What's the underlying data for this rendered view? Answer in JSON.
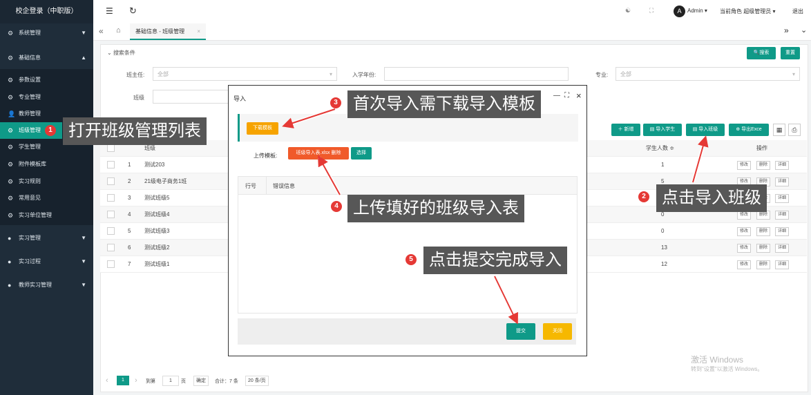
{
  "sidebar": {
    "brand": "校企登录（中职版）",
    "items": [
      {
        "label": "系统管理",
        "caret": "▼"
      },
      {
        "label": "基础信息",
        "caret": "▲"
      },
      {
        "label": "参数设置"
      },
      {
        "label": "专业管理"
      },
      {
        "label": "教师管理"
      },
      {
        "label": "班级管理"
      },
      {
        "label": "学生管理"
      },
      {
        "label": "附件模板库"
      },
      {
        "label": "实习规则"
      },
      {
        "label": "常用意见"
      },
      {
        "label": "实习单位管理"
      },
      {
        "label": "实习管理",
        "caret": "▼"
      },
      {
        "label": "实习过程",
        "caret": "▼"
      },
      {
        "label": "教师实习管理",
        "caret": "▼"
      }
    ]
  },
  "topbar": {
    "menu_icon": "☰",
    "refresh_icon": "↻",
    "avatar_letter": "A",
    "user": "Admin ▾",
    "role": "当前角色 超级管理员 ▾",
    "logout": "退出"
  },
  "tabs": {
    "left_arrow": "«",
    "home_icon": "⌂",
    "active_tab": "基础信息 - 班级管理",
    "close": "×",
    "right_arrow": "»",
    "down_icon": "⌄"
  },
  "search": {
    "title": "搜索条件",
    "search_btn": "搜索",
    "reset_btn": "重置",
    "headteacher_label": "班主任:",
    "headteacher_value": "全部",
    "year_label": "入学年份:",
    "major_label": "专业:",
    "major_value": "全部",
    "class_label": "班级"
  },
  "toolbar": {
    "new": "＋ 新增",
    "import_student": "导入学生",
    "import_class": "导入班级",
    "export_excel": "导出Exce"
  },
  "table": {
    "col_class": "班级",
    "col_students": "学生人数 ≑",
    "col_ops": "操作",
    "rows": [
      {
        "idx": "1",
        "name": "测试203",
        "count": "1"
      },
      {
        "idx": "2",
        "name": "21级电子商务1班",
        "count": "5"
      },
      {
        "idx": "3",
        "name": "测试班级5",
        "count": ""
      },
      {
        "idx": "4",
        "name": "测试班级4",
        "count": "0"
      },
      {
        "idx": "5",
        "name": "测试班级3",
        "count": "0"
      },
      {
        "idx": "6",
        "name": "测试班级2",
        "count": "13"
      },
      {
        "idx": "7",
        "name": "测试班级1",
        "count": "12"
      }
    ],
    "op_edit": "修改",
    "op_delete": "删除",
    "op_detail": "详细"
  },
  "pager": {
    "prev": "‹",
    "current": "1",
    "next": "›",
    "goto_label": "到第",
    "goto_value": "1",
    "page_unit": "页",
    "confirm": "确定",
    "total": "合计：7 条",
    "page_size": "20 条/页"
  },
  "modal": {
    "title": "导入",
    "minimize": "—",
    "maximize": "⛶",
    "close": "×",
    "download_btn": "下载模板",
    "upload_label": "上传模板:",
    "file_btn": "班级导入表.xlsx 删除",
    "choose_btn": "选择",
    "col_row": "行号",
    "col_error": "错误信息",
    "submit": "提交",
    "cancel": "关闭"
  },
  "callouts": {
    "c1": "打开班级管理列表",
    "c2": "点击导入班级",
    "c3": "首次导入需下载导入模板",
    "c4": "上传填好的班级导入表",
    "c5": "点击提交完成导入",
    "n1": "1",
    "n2": "2",
    "n3": "3",
    "n4": "4",
    "n5": "5"
  },
  "watermark": {
    "line1": "激活 Windows",
    "line2": "转到\"设置\"以激活 Windows。"
  },
  "colors": {
    "accent": "#0f9a88",
    "warning": "#f6a300",
    "danger": "#f05a2a",
    "callout_bg": "#575757",
    "badge": "#e53935"
  }
}
